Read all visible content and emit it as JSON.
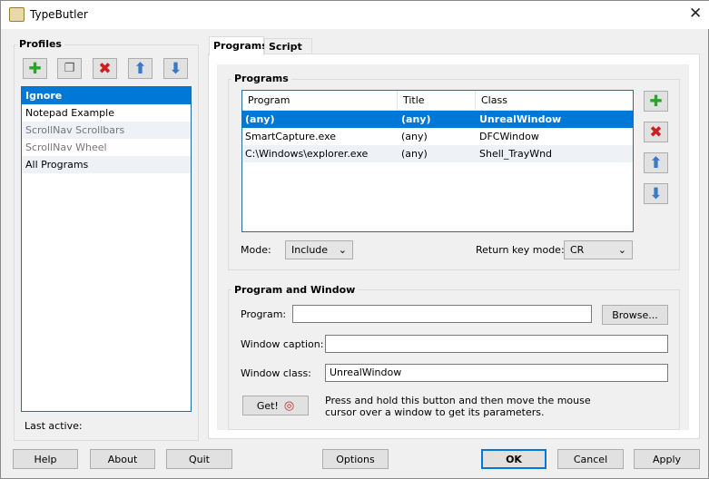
{
  "window": {
    "title": "TypeButler"
  },
  "profiles": {
    "label": "Profiles",
    "items": [
      {
        "label": "Ignore",
        "state": "selected"
      },
      {
        "label": "Notepad Example",
        "state": "normal"
      },
      {
        "label": "ScrollNav Scrollbars",
        "state": "disabled"
      },
      {
        "label": "ScrollNav Wheel",
        "state": "disabled"
      },
      {
        "label": "All Programs",
        "state": "normal"
      }
    ],
    "last_active_label": "Last active:"
  },
  "tabs": [
    {
      "label": "Programs"
    },
    {
      "label": "Script"
    }
  ],
  "programs": {
    "label": "Programs",
    "columns": [
      "Program",
      "Title",
      "Class"
    ],
    "rows": [
      [
        "(any)",
        "(any)",
        "UnrealWindow"
      ],
      [
        "SmartCapture.exe",
        "(any)",
        "DFCWindow"
      ],
      [
        "C:\\Windows\\explorer.exe",
        "(any)",
        "Shell_TrayWnd"
      ]
    ],
    "mode_label": "Mode:",
    "mode_value": "Include",
    "return_label": "Return key mode:",
    "return_value": "CR"
  },
  "pw": {
    "label": "Program and Window",
    "program_label": "Program:",
    "program_value": "",
    "browse": "Browse...",
    "caption_label": "Window caption:",
    "caption_value": "",
    "class_label": "Window class:",
    "class_value": "UnrealWindow",
    "get": "Get!",
    "hint1": "Press and hold this button and then move the mouse",
    "hint2": "cursor over a window to get its parameters."
  },
  "buttons": {
    "help": "Help",
    "about": "About",
    "quit": "Quit",
    "options": "Options",
    "ok": "OK",
    "cancel": "Cancel",
    "apply": "Apply"
  },
  "colors": {
    "accent": "#0078d7",
    "add": "#2aa52a",
    "delete": "#cc1f1f",
    "arrow": "#3a78c8"
  }
}
